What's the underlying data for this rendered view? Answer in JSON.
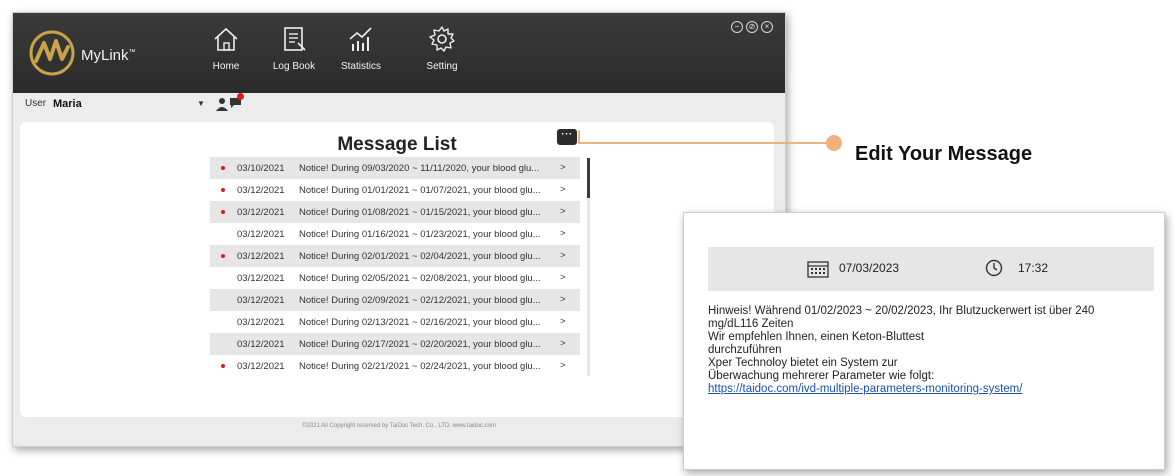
{
  "app": {
    "name": "MyLink",
    "trademark": "™"
  },
  "nav": [
    {
      "label": "Home",
      "icon": "home-icon"
    },
    {
      "label": "Log Book",
      "icon": "logbook-icon"
    },
    {
      "label": "Statistics",
      "icon": "statistics-icon"
    },
    {
      "label": "Setting",
      "icon": "gear-icon"
    }
  ],
  "window_controls": [
    "−",
    "⊘",
    "×"
  ],
  "user": {
    "label": "User",
    "value": "Maria"
  },
  "message_list": {
    "title": "Message List",
    "more_label": "···",
    "rows": [
      {
        "unread": true,
        "shaded": true,
        "date": "03/10/2021",
        "text": "Notice! During 09/03/2020 ~ 11/11/2020, your blood glu...",
        "arrow": ">"
      },
      {
        "unread": true,
        "shaded": false,
        "date": "03/12/2021",
        "text": "Notice! During 01/01/2021 ~ 01/07/2021, your blood glu...",
        "arrow": ">"
      },
      {
        "unread": true,
        "shaded": true,
        "date": "03/12/2021",
        "text": "Notice! During 01/08/2021 ~ 01/15/2021, your blood glu...",
        "arrow": ">"
      },
      {
        "unread": false,
        "shaded": false,
        "date": "03/12/2021",
        "text": "Notice! During 01/16/2021 ~ 01/23/2021, your blood glu...",
        "arrow": ">"
      },
      {
        "unread": true,
        "shaded": true,
        "date": "03/12/2021",
        "text": "Notice! During 02/01/2021 ~ 02/04/2021, your blood glu...",
        "arrow": ">"
      },
      {
        "unread": false,
        "shaded": false,
        "date": "03/12/2021",
        "text": "Notice! During 02/05/2021 ~ 02/08/2021, your blood glu...",
        "arrow": ">"
      },
      {
        "unread": false,
        "shaded": true,
        "date": "03/12/2021",
        "text": "Notice! During 02/09/2021 ~ 02/12/2021, your blood glu...",
        "arrow": ">"
      },
      {
        "unread": false,
        "shaded": false,
        "date": "03/12/2021",
        "text": "Notice! During 02/13/2021 ~ 02/16/2021, your blood glu...",
        "arrow": ">"
      },
      {
        "unread": false,
        "shaded": true,
        "date": "03/12/2021",
        "text": "Notice! During 02/17/2021 ~ 02/20/2021, your blood glu...",
        "arrow": ">"
      },
      {
        "unread": true,
        "shaded": false,
        "date": "03/12/2021",
        "text": "Notice! During 02/21/2021 ~ 02/24/2021, your blood glu...",
        "arrow": ">"
      }
    ]
  },
  "footer": "©2021 All Copyright reserved by TaiDoc Tech. Co., LTD.     www.taidoc.com",
  "callout": {
    "label": "Edit Your Message"
  },
  "detail": {
    "date": "07/03/2023",
    "time": "17:32",
    "lines": [
      "Hinweis! Während 01/02/2023 ~ 20/02/2023, Ihr Blutzuckerwert ist über 240",
      "mg/dL116 Zeiten",
      "Wir empfehlen Ihnen, einen Keton-Bluttest",
      "durchzuführen",
      "Xper Technoloy bietet ein System zur",
      "Überwachung mehrerer Parameter wie folgt:"
    ],
    "link": "https://taidoc.com/ivd-multiple-parameters-monitoring-system/"
  },
  "colors": {
    "header_bg": "#2f2f2f",
    "accent_gold": "#c9a34a",
    "unread_dot": "#e01c1c",
    "callout": "#f0b27a",
    "link": "#1a4fb5"
  }
}
